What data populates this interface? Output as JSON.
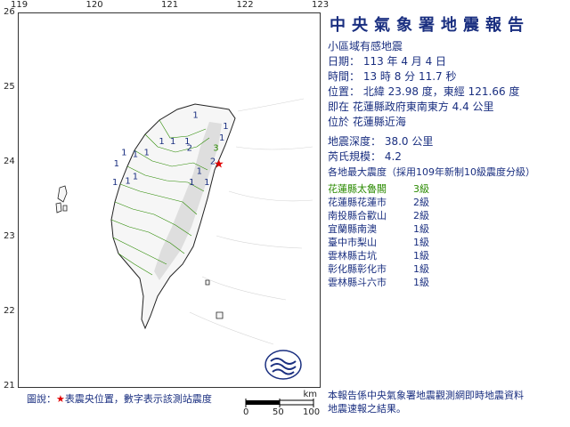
{
  "report": {
    "title": "中央氣象署地震報告",
    "subtitle": "小區域有感地震",
    "date_line": "日期： 113 年 4 月 4 日",
    "time_line": "時間： 13 時 8 分 11.7 秒",
    "location_line": "位置： 北緯 23.98 度，東經 121.66 度",
    "relative_line": "即在 花蓮縣政府東南東方 4.4 公里",
    "region_line": "位於 花蓮縣近海",
    "depth_line": "地震深度： 38.0 公里",
    "magnitude_line": "芮氏規模： 4.2",
    "intensity_header": "各地最大震度（採用109年新制10級震度分級）",
    "intensity_rows": [
      {
        "place": "花蓮縣太魯閣",
        "level": "3級"
      },
      {
        "place": "花蓮縣花蓮市",
        "level": "2級"
      },
      {
        "place": "南投縣合歡山",
        "level": "2級"
      },
      {
        "place": "宜蘭縣南澳",
        "level": "1級"
      },
      {
        "place": "臺中市梨山",
        "level": "1級"
      },
      {
        "place": "雲林縣古坑",
        "level": "1級"
      },
      {
        "place": "彰化縣彰化市",
        "level": "1級"
      },
      {
        "place": "雲林縣斗六市",
        "level": "1級"
      }
    ],
    "footnote_1": "本報告係中央氣象署地震觀測網即時地震資料",
    "footnote_2": "地震速報之結果。"
  },
  "map": {
    "lon_labels": [
      "119",
      "120",
      "121",
      "122",
      "123"
    ],
    "lat_labels": [
      "26",
      "25",
      "24",
      "23",
      "22",
      "21"
    ],
    "legend_prefix": "圖說：",
    "legend_star": "★",
    "legend_text": "表震央位置，數字表示該測站震度",
    "scale_unit": "km",
    "scale_ticks": [
      "0",
      "50",
      "100"
    ],
    "epicenter": {
      "lon": 121.66,
      "lat": 23.98
    },
    "stations": [
      {
        "lon": 121.62,
        "lat": 24.16,
        "label": "3",
        "color": "#2a8a00"
      },
      {
        "lon": 121.58,
        "lat": 23.98,
        "label": "2",
        "color": "#1a2f80"
      },
      {
        "lon": 121.27,
        "lat": 24.16,
        "label": "2",
        "color": "#1a2f80"
      },
      {
        "lon": 121.75,
        "lat": 24.45,
        "label": "1",
        "color": "#1a2f80"
      },
      {
        "lon": 121.24,
        "lat": 24.25,
        "label": "1",
        "color": "#1a2f80"
      },
      {
        "lon": 121.05,
        "lat": 24.25,
        "label": "1",
        "color": "#1a2f80"
      },
      {
        "lon": 120.9,
        "lat": 24.25,
        "label": "1",
        "color": "#1a2f80"
      },
      {
        "lon": 121.35,
        "lat": 24.6,
        "label": "1",
        "color": "#1a2f80"
      },
      {
        "lon": 121.7,
        "lat": 24.3,
        "label": "1",
        "color": "#1a2f80"
      },
      {
        "lon": 121.4,
        "lat": 23.85,
        "label": "1",
        "color": "#1a2f80"
      },
      {
        "lon": 121.3,
        "lat": 23.7,
        "label": "1",
        "color": "#1a2f80"
      },
      {
        "lon": 121.5,
        "lat": 23.7,
        "label": "1",
        "color": "#1a2f80"
      },
      {
        "lon": 120.7,
        "lat": 24.1,
        "label": "1",
        "color": "#1a2f80"
      },
      {
        "lon": 120.55,
        "lat": 24.08,
        "label": "1",
        "color": "#1a2f80"
      },
      {
        "lon": 120.4,
        "lat": 24.1,
        "label": "1",
        "color": "#1a2f80"
      },
      {
        "lon": 120.3,
        "lat": 23.95,
        "label": "1",
        "color": "#1a2f80"
      },
      {
        "lon": 120.45,
        "lat": 23.72,
        "label": "1",
        "color": "#1a2f80"
      },
      {
        "lon": 120.55,
        "lat": 23.78,
        "label": "1",
        "color": "#1a2f80"
      },
      {
        "lon": 120.28,
        "lat": 23.7,
        "label": "1",
        "color": "#1a2f80"
      }
    ],
    "colors": {
      "land": "#ffffff",
      "terrain_shade": "#d8d8d8",
      "county_border": "#2a8a00",
      "coast": "#222222",
      "epicenter": "#e00000"
    }
  }
}
